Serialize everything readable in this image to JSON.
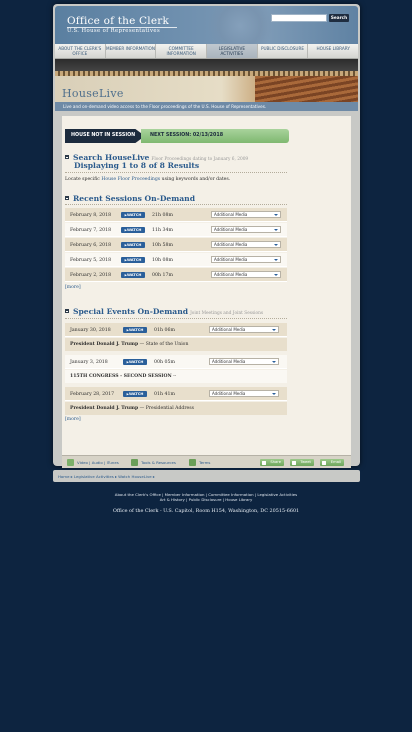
{
  "header": {
    "title": "Office of the Clerk",
    "subtitle": "U.S. House of Representatives",
    "search_button": "Search"
  },
  "nav": {
    "items": [
      {
        "label": "About the Clerk's Office"
      },
      {
        "label": "Member Information"
      },
      {
        "label": "Committee Information"
      },
      {
        "label": "Legislative Activities"
      },
      {
        "label": "Public Disclosure"
      },
      {
        "label": "House Library"
      }
    ]
  },
  "banner": {
    "title": "HouseLive",
    "description": "Live and on-demand video access to the Floor proceedings of the U.S. House of Representatives."
  },
  "status": {
    "state": "HOUSE NOT IN SESSION",
    "next": "NEXT SESSION: 02/13/2018"
  },
  "search_section": {
    "heading": "Search HouseLive",
    "note": "Floor Proceedings dating to January 6, 2009",
    "results": "Displaying 1 to 8 of 8 Results",
    "locate_prefix": "Locate specific",
    "locate_link": "House Floor Proceedings",
    "locate_suffix": "using keywords and/or dates."
  },
  "recent": {
    "heading": "Recent Sessions On-Demand",
    "watch_label": "WATCH",
    "select_label": "Additional Media",
    "rows": [
      {
        "date": "February 8, 2018",
        "duration": "21h 08m"
      },
      {
        "date": "February 7, 2018",
        "duration": "11h 34m"
      },
      {
        "date": "February 6, 2018",
        "duration": "10h 58m"
      },
      {
        "date": "February 5, 2018",
        "duration": "10h 08m"
      },
      {
        "date": "February 2, 2018",
        "duration": "00h 17m"
      }
    ],
    "more": "[more]"
  },
  "special": {
    "heading": "Special Events On-Demand",
    "note": "Joint Meetings and Joint Sessions",
    "watch_label": "WATCH",
    "select_label": "Additional Media",
    "events": [
      {
        "date": "January 30, 2018",
        "duration": "01h 06m",
        "who": "President Donald J. Trump",
        "what": "— State of the Union"
      },
      {
        "date": "January 3, 2018",
        "duration": "00h 05m",
        "who": "115TH CONGRESS - SECOND SESSION",
        "what": "--"
      },
      {
        "date": "February 28, 2017",
        "duration": "01h 41m",
        "who": "President Donald J. Trump",
        "what": "— Presidential Address"
      }
    ],
    "more": "[more]"
  },
  "footer_bar": {
    "video": "Video",
    "audio": "Audio",
    "itunes": "iTunes",
    "tools": "Tools & Resources",
    "terms": "Terms",
    "share": "Share",
    "tweet": "Tweet",
    "email": "Email"
  },
  "breadcrumb": "Home ▸ Legislative Activities ▸ Watch HouseLive ▸",
  "bottom": {
    "line1": "About the Clerk's Office | Member Information | Committee Information | Legislative Activities",
    "line2": "Art & History | Public Disclosure | House Library",
    "address": "Office of the Clerk - U.S. Capitol, Room H154, Washington, DC 20515-6601"
  }
}
